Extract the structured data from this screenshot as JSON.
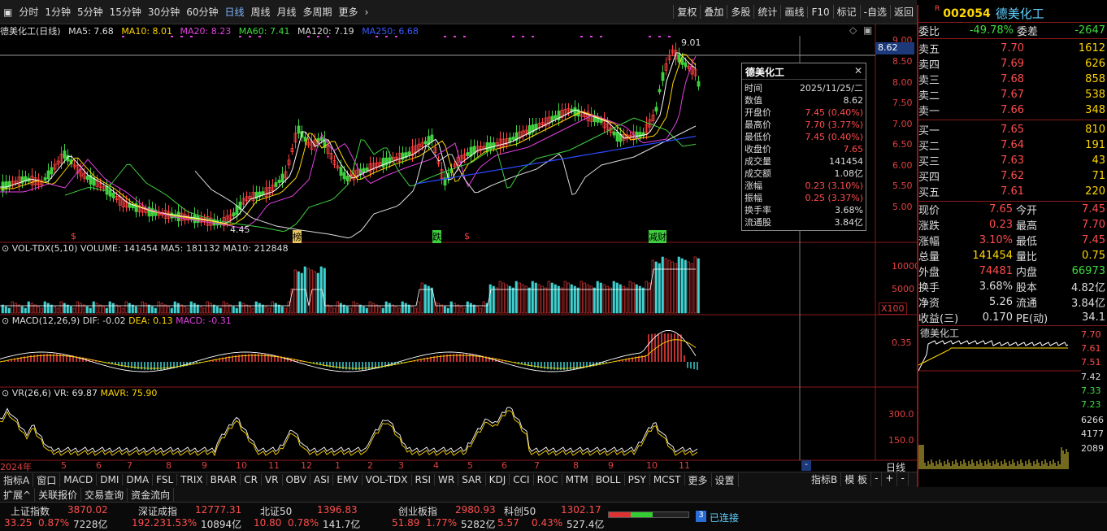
{
  "toolbar": {
    "left": [
      "分时",
      "1分钟",
      "5分钟",
      "15分钟",
      "30分钟",
      "60分钟",
      "日线",
      "周线",
      "月线",
      "多周期",
      "更多"
    ],
    "active": "日线",
    "right": [
      "复权",
      "叠加",
      "多股",
      "统计",
      "画线",
      "F10",
      "标记",
      "-自选",
      "返回"
    ]
  },
  "legend": {
    "title": "德美化工(日线)",
    "ma5": "MA5: 7.68",
    "ma10": "MA10: 8.01",
    "ma20": "MA20: 8.23",
    "ma60": "MA60: 7.41",
    "ma120": "MA120: 7.19",
    "ma250": "MA250: 6.68"
  },
  "price_axis": [
    "9.00",
    "8.50",
    "8.00",
    "7.50",
    "7.00",
    "6.50",
    "6.00",
    "5.50",
    "5.00"
  ],
  "price_current": "8.62",
  "annotations": {
    "high": "9.01",
    "low": "4.45",
    "marks": [
      "$",
      "榜",
      "跌",
      "$",
      "减财"
    ]
  },
  "vol": {
    "label": "VOL-TDX(5,10) VOLUME: 141454 MA5: 181132 MA10: 212848",
    "axis": [
      "10000",
      "5000"
    ],
    "unit": "X100"
  },
  "macd": {
    "label_a": "MACD(12,26,9)",
    "dif": "DIF: -0.02",
    "dea": "DEA: 0.13",
    "macd": "MACD: -0.31",
    "axis": "0.35"
  },
  "vr": {
    "label_a": "VR(26,6)",
    "vr": "VR: 69.87",
    "mavr": "MAVR: 75.90",
    "axis": [
      "300.0",
      "150.0"
    ]
  },
  "timeaxis": [
    "2024年",
    "5",
    "6",
    "7",
    "8",
    "9",
    "10",
    "11",
    "12",
    "1",
    "2",
    "3",
    "4",
    "5",
    "6",
    "7",
    "8",
    "9",
    "10",
    "11"
  ],
  "popup": {
    "title": "德美化工",
    "rows": [
      [
        "时间",
        "2025/11/25/二"
      ],
      [
        "数值",
        "8.62"
      ],
      [
        "开盘价",
        "7.45 (0.40%)"
      ],
      [
        "最高价",
        "7.70 (3.77%)"
      ],
      [
        "最低价",
        "7.45 (0.40%)"
      ],
      [
        "收盘价",
        "7.65"
      ],
      [
        "成交量",
        "141454"
      ],
      [
        "成交额",
        "1.08亿"
      ],
      [
        "涨幅",
        "0.23 (3.10%)"
      ],
      [
        "振幅",
        "0.25 (3.37%)"
      ],
      [
        "换手率",
        "3.68%"
      ],
      [
        "流通股",
        "3.84亿"
      ]
    ]
  },
  "quote": {
    "badge": "R",
    "code": "002054",
    "name": "德美化工",
    "weibi_label": "委比",
    "weibi": "-49.78%",
    "weicha_label": "委差",
    "weicha": "-2647",
    "asks": [
      [
        "卖五",
        "7.70",
        "1612"
      ],
      [
        "卖四",
        "7.69",
        "626"
      ],
      [
        "卖三",
        "7.68",
        "858"
      ],
      [
        "卖二",
        "7.67",
        "538"
      ],
      [
        "卖一",
        "7.66",
        "348"
      ]
    ],
    "bids": [
      [
        "买一",
        "7.65",
        "810"
      ],
      [
        "买二",
        "7.64",
        "191"
      ],
      [
        "买三",
        "7.63",
        "43"
      ],
      [
        "买四",
        "7.62",
        "71"
      ],
      [
        "买五",
        "7.61",
        "220"
      ]
    ],
    "stats": [
      [
        "现价",
        "7.65",
        "今开",
        "7.45"
      ],
      [
        "涨跌",
        "0.23",
        "最高",
        "7.70"
      ],
      [
        "涨幅",
        "3.10%",
        "最低",
        "7.45"
      ],
      [
        "总量",
        "141454",
        "量比",
        "0.75"
      ],
      [
        "外盘",
        "74481",
        "内盘",
        "66973"
      ],
      [
        "换手",
        "3.68%",
        "股本",
        "4.82亿"
      ],
      [
        "净资",
        "5.26",
        "流通",
        "3.84亿"
      ],
      [
        "收益(三)",
        "0.170",
        "PE(动)",
        "34.1"
      ]
    ]
  },
  "mini": {
    "title": "德美化工",
    "axis": [
      "7.70",
      "7.61",
      "7.51",
      "7.42",
      "7.33",
      "7.23"
    ],
    "vol_axis": [
      "6266",
      "4177",
      "2089"
    ]
  },
  "bottom_tabs": [
    "指标A",
    "窗口",
    "MACD",
    "DMI",
    "DMA",
    "FSL",
    "TRIX",
    "BRAR",
    "CR",
    "VR",
    "OBV",
    "ASI",
    "EMV",
    "VOL-TDX",
    "RSI",
    "WR",
    "SAR",
    "KDJ",
    "CCI",
    "ROC",
    "MTM",
    "BOLL",
    "PSY",
    "MCST",
    "更多",
    "设置"
  ],
  "bottom_right": [
    "指标B",
    "模 板",
    "-",
    "+",
    "-"
  ],
  "bottom_tabs2": [
    "扩展^",
    "关联报价",
    "交易查询",
    "资金流向"
  ],
  "period_btn": "日线",
  "index": [
    [
      "上证指数",
      "3870.02",
      "33.25",
      "0.87%",
      "7228亿"
    ],
    [
      "深证成指",
      "12777.31",
      "192.23",
      "1.53%",
      "10894亿"
    ],
    [
      "北证50",
      "1396.83",
      "10.80",
      "0.78%",
      "141.7亿"
    ],
    [
      "创业板指",
      "2980.93",
      "51.89",
      "1.77%",
      "5282亿"
    ],
    [
      "科创50",
      "1302.17",
      "5.57",
      "0.43%",
      "527.4亿"
    ]
  ],
  "conn": {
    "num": "3",
    "text": "已连接"
  }
}
